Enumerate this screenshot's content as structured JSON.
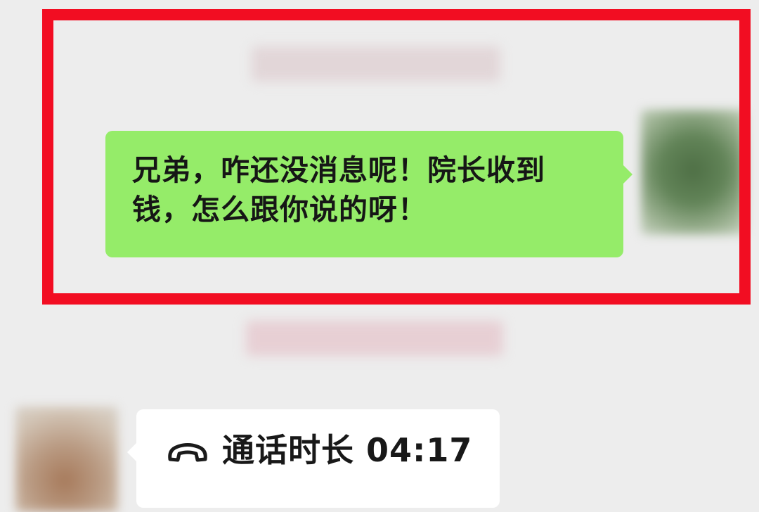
{
  "messages": {
    "sent_text": "兄弟，咋还没消息呢！院长收到钱，怎么跟你说的呀！",
    "call_label": "通话时长 04:17"
  },
  "icons": {
    "call": "phone-hangup-icon"
  },
  "colors": {
    "highlight_border": "#f20d22",
    "sent_bubble": "#95ec69",
    "received_bubble": "#ffffff",
    "background": "#ededed"
  }
}
